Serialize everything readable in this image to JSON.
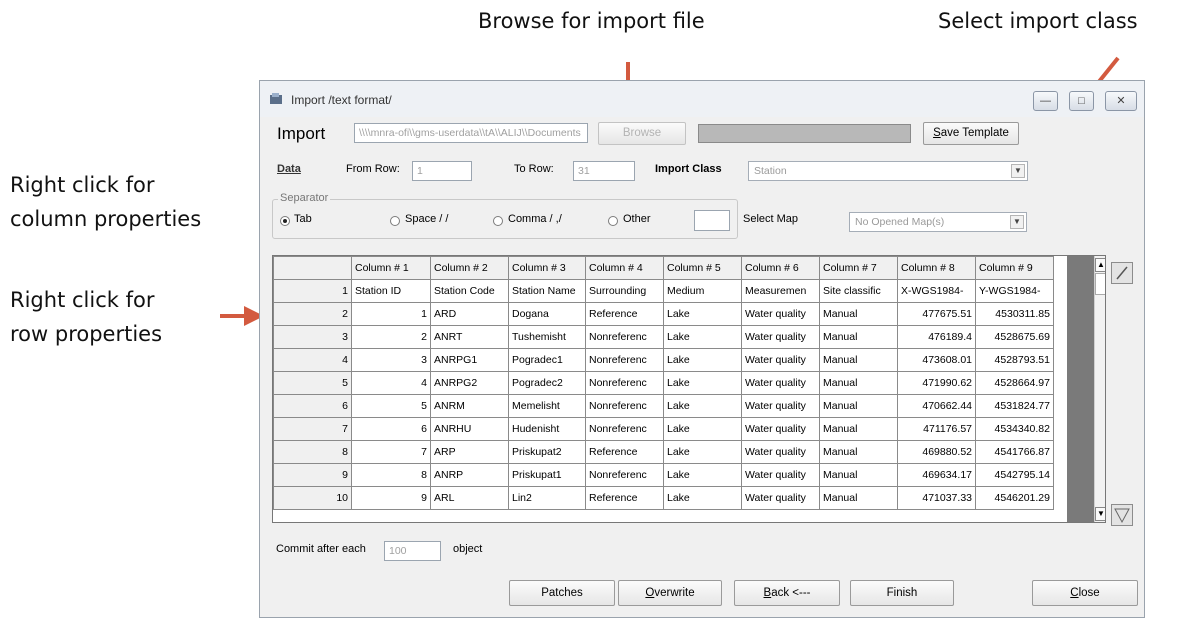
{
  "annotations": {
    "browse": "Browse for import file",
    "select_class": "Select import class",
    "column_props_l1": "Right click for",
    "column_props_l2": "column properties",
    "row_props_l1": "Right click for",
    "row_props_l2": "row properties"
  },
  "window": {
    "title": "Import /text format/",
    "controls": {
      "minimize": "—",
      "maximize": "□",
      "close": "✕"
    }
  },
  "import": {
    "label": "Import",
    "path_value": "\\\\\\\\mnra-ofi\\\\gms-userdata\\\\tA\\\\ALIJ\\\\Documents",
    "browse_button": "Browse",
    "template_button": "Save Template",
    "data_label": "Data",
    "from_row_label": "From Row:",
    "from_row_value": "1",
    "to_row_label": "To Row:",
    "to_row_value": "31",
    "import_class_label": "Import Class",
    "import_class_value": "Station",
    "separator_label": "Separator",
    "separators": [
      "Tab",
      "Space / /",
      "Comma / ,/",
      "Other"
    ],
    "selected_separator": "Tab",
    "select_map_label": "Select Map",
    "select_map_value": "No Opened Map(s)"
  },
  "grid": {
    "columns": [
      "Column # 1",
      "Column # 2",
      "Column # 3",
      "Column # 4",
      "Column # 5",
      "Column # 6",
      "Column # 7",
      "Column # 8",
      "Column # 9"
    ],
    "rows": [
      {
        "n": "1",
        "cells": [
          "Station ID",
          "Station Code",
          "Station Name",
          "Surrounding",
          "Medium",
          "Measuremen",
          "Site classific",
          "X-WGS1984-",
          "Y-WGS1984-"
        ]
      },
      {
        "n": "2",
        "cells": [
          "1",
          "ARD",
          "Dogana",
          "Reference",
          "Lake",
          "Water quality",
          "Manual",
          "477675.51",
          "4530311.85"
        ]
      },
      {
        "n": "3",
        "cells": [
          "2",
          "ANRT",
          "Tushemisht",
          "Nonreferenc",
          "Lake",
          "Water quality",
          "Manual",
          "476189.4",
          "4528675.69"
        ]
      },
      {
        "n": "4",
        "cells": [
          "3",
          "ANRPG1",
          "Pogradec1",
          "Nonreferenc",
          "Lake",
          "Water quality",
          "Manual",
          "473608.01",
          "4528793.51"
        ]
      },
      {
        "n": "5",
        "cells": [
          "4",
          "ANRPG2",
          "Pogradec2",
          "Nonreferenc",
          "Lake",
          "Water quality",
          "Manual",
          "471990.62",
          "4528664.97"
        ]
      },
      {
        "n": "6",
        "cells": [
          "5",
          "ANRM",
          "Memelisht",
          "Nonreferenc",
          "Lake",
          "Water quality",
          "Manual",
          "470662.44",
          "4531824.77"
        ]
      },
      {
        "n": "7",
        "cells": [
          "6",
          "ANRHU",
          "Hudenisht",
          "Nonreferenc",
          "Lake",
          "Water quality",
          "Manual",
          "471176.57",
          "4534340.82"
        ]
      },
      {
        "n": "8",
        "cells": [
          "7",
          "ARP",
          "Priskupat2",
          "Reference",
          "Lake",
          "Water quality",
          "Manual",
          "469880.52",
          "4541766.87"
        ]
      },
      {
        "n": "9",
        "cells": [
          "8",
          "ANRP",
          "Priskupat1",
          "Nonreferenc",
          "Lake",
          "Water quality",
          "Manual",
          "469634.17",
          "4542795.14"
        ]
      },
      {
        "n": "10",
        "cells": [
          "9",
          "ARL",
          "Lin2",
          "Reference",
          "Lake",
          "Water quality",
          "Manual",
          "471037.33",
          "4546201.29"
        ]
      }
    ]
  },
  "footer": {
    "commit_label": "Commit after each",
    "commit_value": "100",
    "object_label": "object",
    "buttons": [
      "Patches",
      "Overwrite",
      "Back <---",
      "Finish",
      "Close"
    ]
  },
  "colors": {
    "arrow": "#d35a3f",
    "grid_dark_column": "#7a7a7a"
  }
}
